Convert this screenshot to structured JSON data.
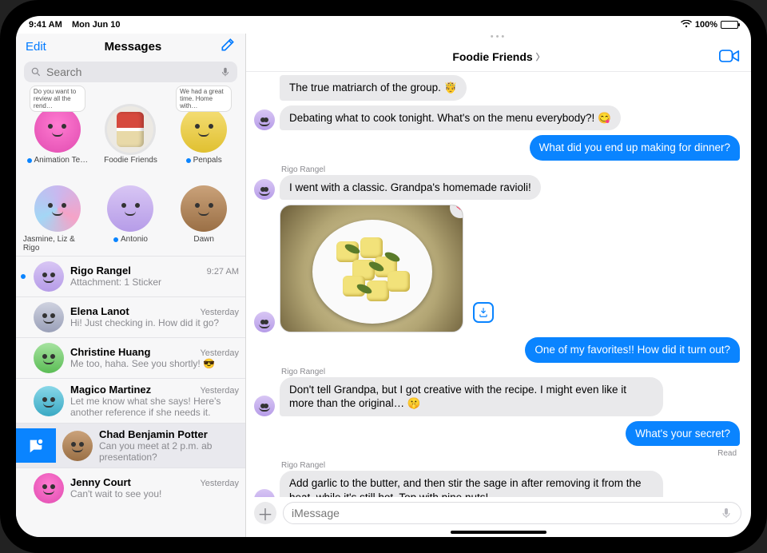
{
  "status": {
    "time": "9:41 AM",
    "date": "Mon Jun 10",
    "battery_pct": "100%",
    "wifi": "􀙇"
  },
  "sidebar": {
    "edit": "Edit",
    "title": "Messages",
    "search_placeholder": "Search",
    "pins": [
      {
        "label": "Animation Te…",
        "preview": "Do you want to review all the rend…",
        "unread": true,
        "avatar": "av-pink"
      },
      {
        "label": "Foodie Friends",
        "preview": "",
        "unread": false,
        "avatar": "soup",
        "selected": true
      },
      {
        "label": "Penpals",
        "preview": "We had a great time. Home with…",
        "unread": true,
        "avatar": "av-yellow"
      },
      {
        "label": "Jasmine, Liz & Rigo",
        "preview": "",
        "unread": false,
        "avatar": "av-multi"
      },
      {
        "label": "Antonio",
        "preview": "",
        "unread": true,
        "avatar": "av-purple"
      },
      {
        "label": "Dawn",
        "preview": "",
        "unread": false,
        "avatar": "av-brown"
      }
    ],
    "conversations": [
      {
        "name": "Rigo Rangel",
        "time": "9:27 AM",
        "preview": "Attachment: 1 Sticker",
        "unread": true,
        "avatar": "av-purple"
      },
      {
        "name": "Elena Lanot",
        "time": "Yesterday",
        "preview": "Hi! Just checking in. How did it go?",
        "unread": false,
        "avatar": "av-gray"
      },
      {
        "name": "Christine Huang",
        "time": "Yesterday",
        "preview": "Me too, haha. See you shortly! 😎",
        "unread": false,
        "avatar": "av-green"
      },
      {
        "name": "Magico Martinez",
        "time": "Yesterday",
        "preview": "Let me know what she says! Here's another reference if she needs it.",
        "unread": false,
        "avatar": "av-teal"
      },
      {
        "name": "Chad Benjamin Potter",
        "time": "",
        "preview": "Can you meet at 2 p.m. ab presentation?",
        "unread": false,
        "avatar": "av-brown",
        "swiped": true
      },
      {
        "name": "Jenny Court",
        "time": "Yesterday",
        "preview": "Can't wait to see you!",
        "unread": false,
        "avatar": "av-pink"
      }
    ]
  },
  "chat": {
    "title": "Foodie Friends",
    "messages": [
      {
        "kind": "other_cut",
        "text": "The true matriarch of the group. 🤴"
      },
      {
        "kind": "other",
        "text": "Debating what to cook tonight. What's on the menu everybody?! 😋",
        "show_avatar": true
      },
      {
        "kind": "me",
        "text": "What did you end up making for dinner?"
      },
      {
        "kind": "label",
        "text": "Rigo Rangel"
      },
      {
        "kind": "other",
        "text": "I went with a classic. Grandpa's homemade ravioli!",
        "show_avatar": true
      },
      {
        "kind": "photo"
      },
      {
        "kind": "me",
        "text": "One of my favorites!! How did it turn out?"
      },
      {
        "kind": "label",
        "text": "Rigo Rangel"
      },
      {
        "kind": "other",
        "text": "Don't tell Grandpa, but I got creative with the recipe. I might even like it more than the original… 🤫",
        "show_avatar": true
      },
      {
        "kind": "me",
        "text": "What's your secret?"
      },
      {
        "kind": "read",
        "text": "Read"
      },
      {
        "kind": "label",
        "text": "Rigo Rangel"
      },
      {
        "kind": "other",
        "text": "Add garlic to the butter, and then stir the sage in after removing it from the heat, while it's still hot. Top with pine nuts!",
        "show_avatar": true
      }
    ],
    "compose_placeholder": "iMessage"
  }
}
